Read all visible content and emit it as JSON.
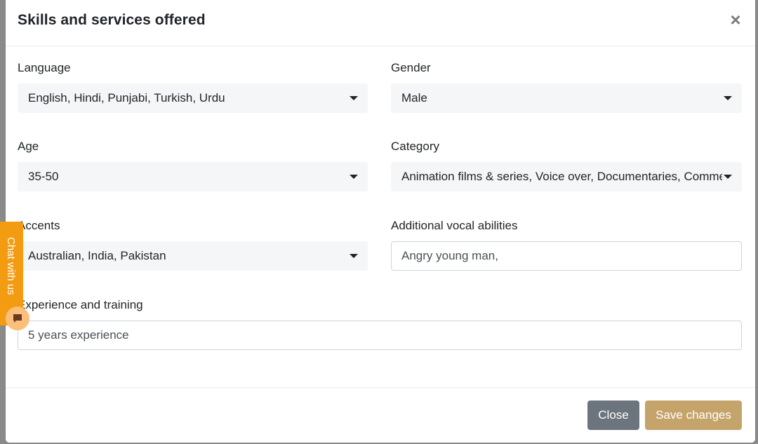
{
  "modal": {
    "title": "Skills and services offered",
    "close_glyph": "×"
  },
  "fields": {
    "language": {
      "label": "Language",
      "value": "English, Hindi, Punjabi, Turkish, Urdu"
    },
    "gender": {
      "label": "Gender",
      "value": "Male"
    },
    "age": {
      "label": "Age",
      "value": "35-50"
    },
    "category": {
      "label": "Category",
      "value": "Animation films & series, Voice over, Documentaries, Commercials"
    },
    "accents": {
      "label": "Accents",
      "value": "Australian, India, Pakistan"
    },
    "vocal": {
      "label": "Additional vocal abilities",
      "value": "Angry young man,"
    },
    "experience": {
      "label": "Experience and training",
      "value": "5 years experience"
    }
  },
  "footer": {
    "close_label": "Close",
    "save_label": "Save changes"
  },
  "chat_widget": {
    "label": "Chat with us",
    "icon": "chat-icon"
  },
  "colors": {
    "save_button": "#c5a46b",
    "close_button": "#6c757d",
    "chat_tab": "#f39c12"
  }
}
